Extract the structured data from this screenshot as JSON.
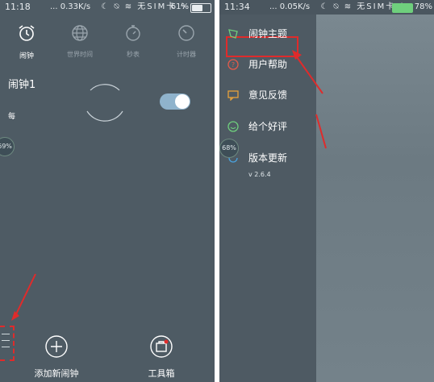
{
  "left": {
    "statusbar": {
      "time": "11:18",
      "net": "... 0.33K/s",
      "carrier": "无SIM卡",
      "battery": "61%",
      "battery_level": 0.61
    },
    "tabs": [
      {
        "label": "闹钟",
        "icon": "alarm-clock-icon",
        "active": true
      },
      {
        "label": "世界时间",
        "icon": "globe-icon",
        "active": false
      },
      {
        "label": "秒表",
        "icon": "stopwatch-icon",
        "active": false
      },
      {
        "label": "计时器",
        "icon": "timer-icon",
        "active": false
      }
    ],
    "alarm": {
      "name": "闹钟1",
      "repeat": "每",
      "enabled": true
    },
    "floating_ball": "69%",
    "bottom": {
      "add_label": "添加新闹钟",
      "toolbox_label": "工具箱"
    }
  },
  "right": {
    "statusbar": {
      "time": "11:34",
      "net": "... 0.05K/s",
      "carrier": "无SIM卡",
      "battery": "78%",
      "battery_level": 0.78
    },
    "menu": [
      {
        "label": "闹钟主题",
        "icon": "theme-icon"
      },
      {
        "label": "用户帮助",
        "icon": "help-icon"
      },
      {
        "label": "意见反馈",
        "icon": "feedback-icon"
      },
      {
        "label": "给个好评",
        "icon": "smile-icon"
      },
      {
        "label": "版本更新",
        "icon": "update-icon"
      }
    ],
    "version": "v 2.6.4",
    "floating_ball": "68%"
  },
  "colors": {
    "accent_red": "#e02b2b",
    "toggle_on": "#8fb3cc",
    "icon_green": "#6fcf7d",
    "icon_blue": "#4aa3df"
  }
}
